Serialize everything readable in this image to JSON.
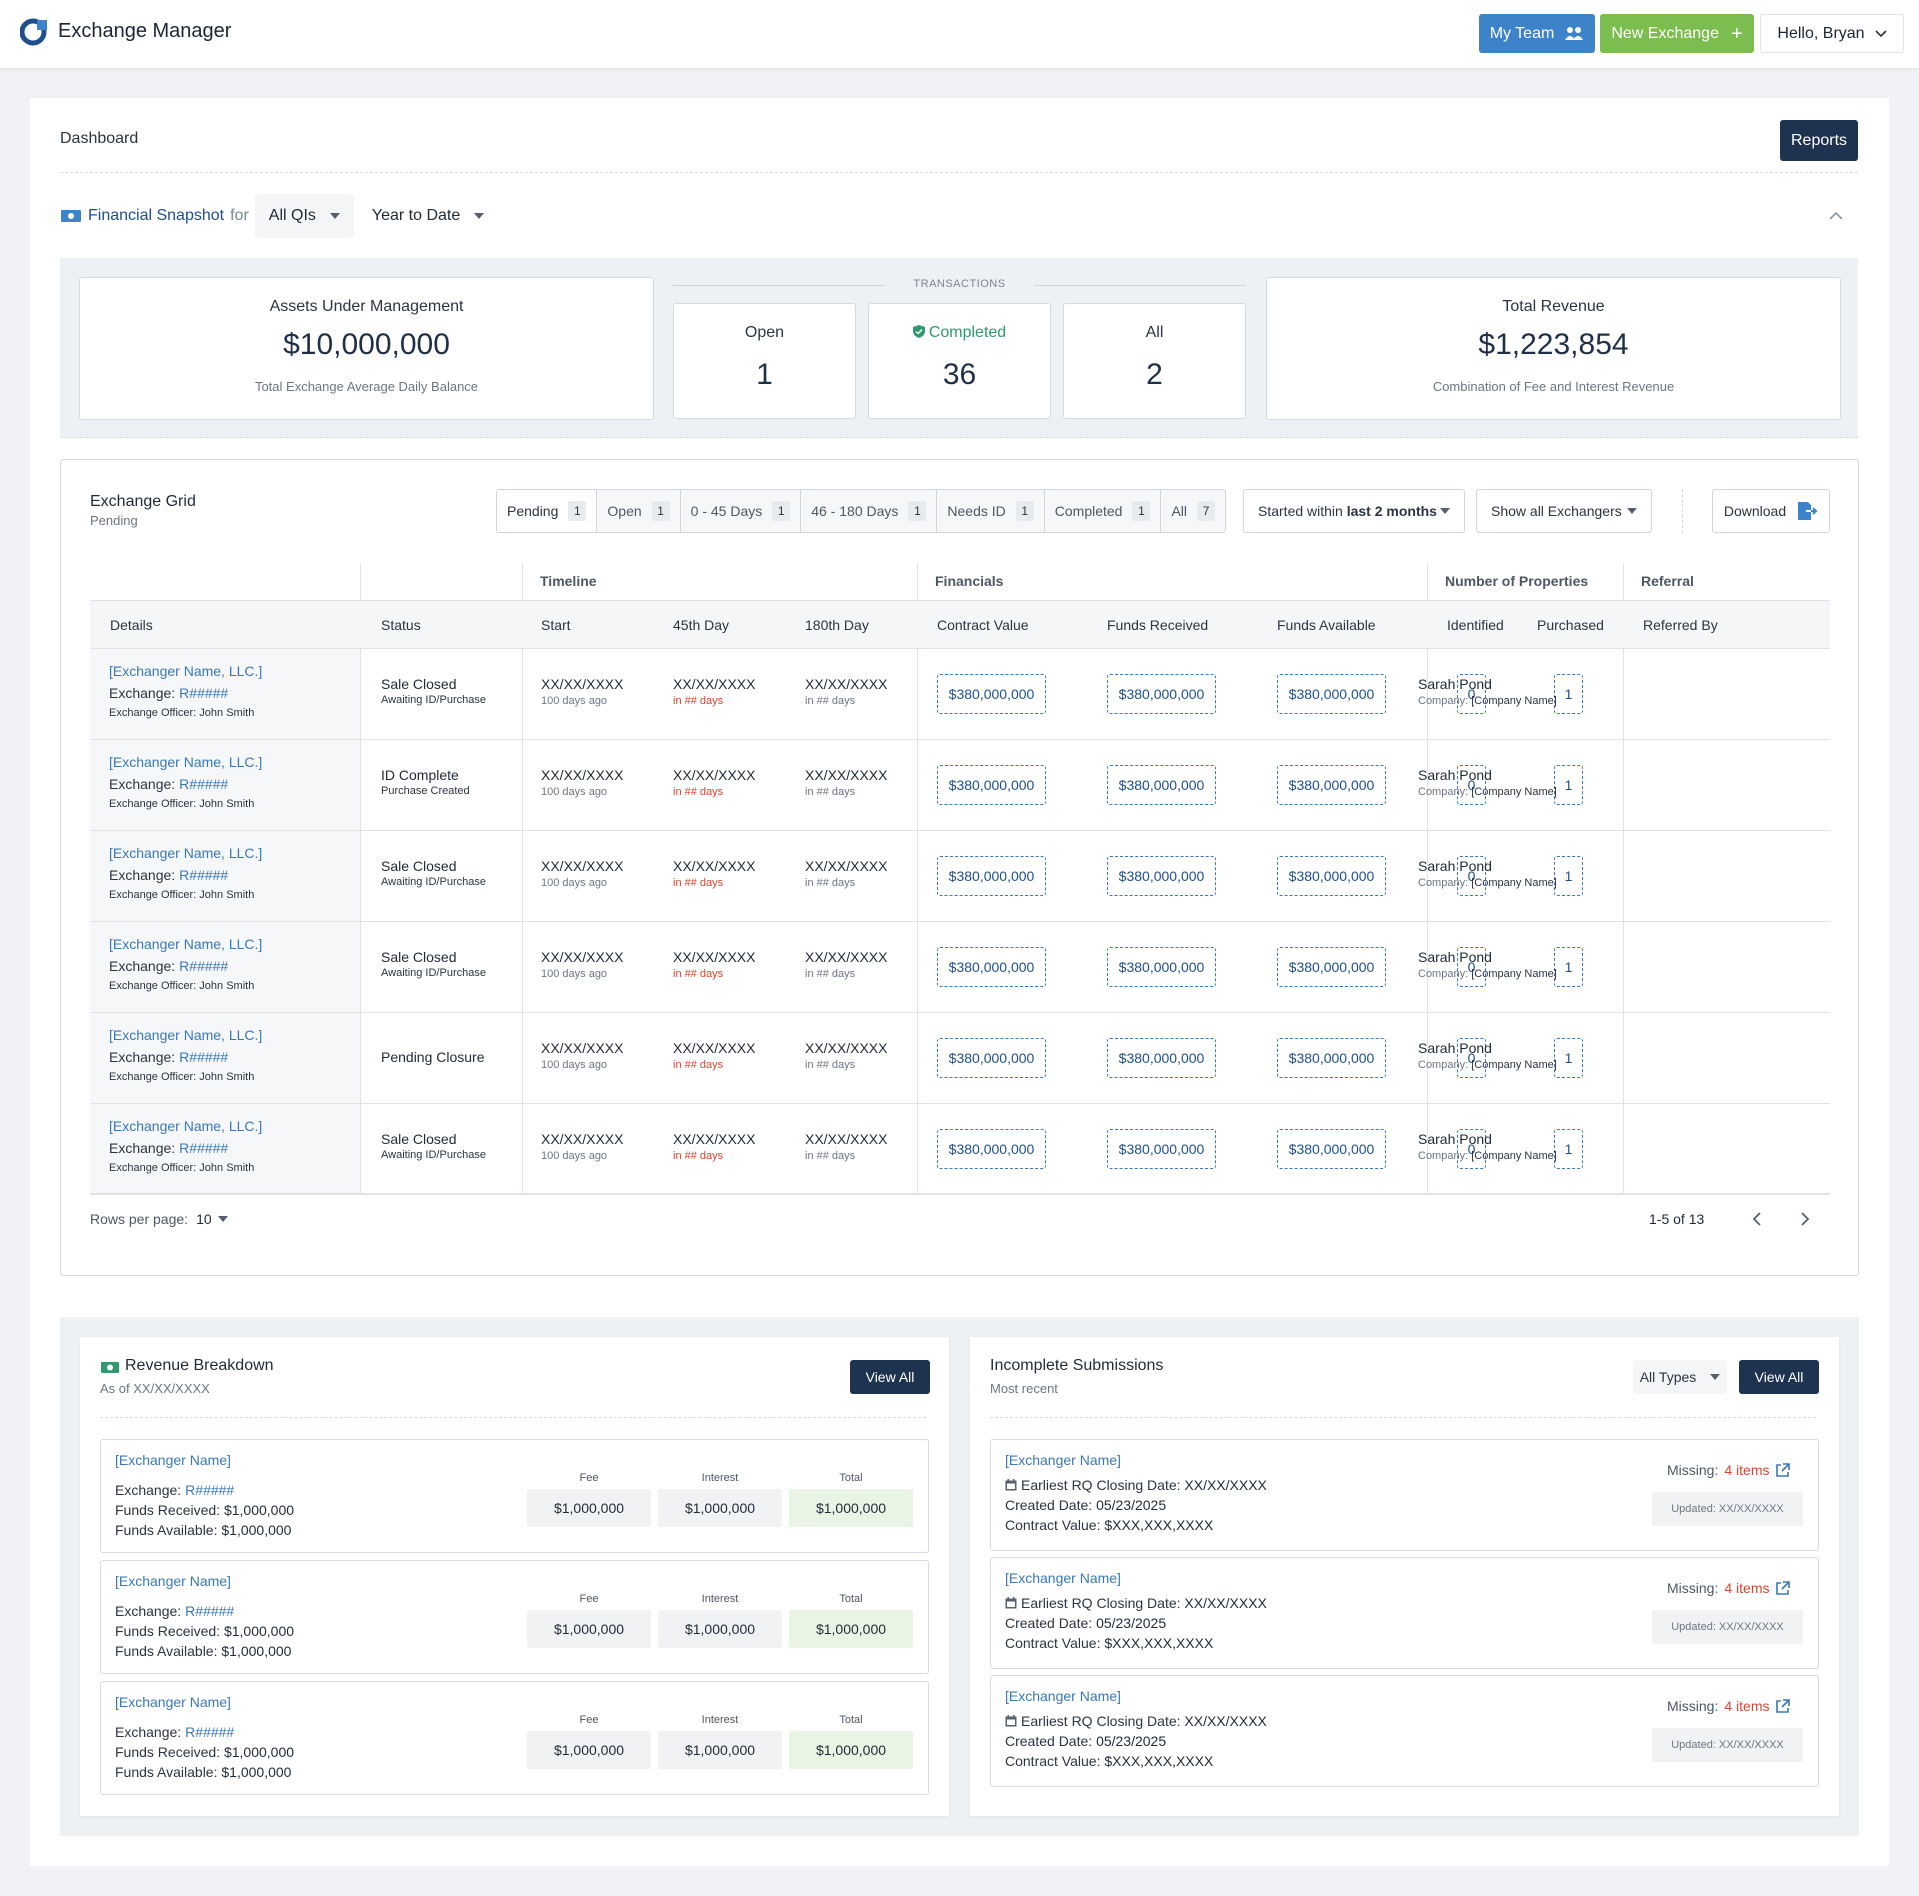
{
  "app": {
    "title": "Exchange Manager"
  },
  "header": {
    "my_team": "My Team",
    "new_exchange": "New Exchange",
    "user_greeting": "Hello, Bryan"
  },
  "dashboard": {
    "title": "Dashboard",
    "reports_button": "Reports"
  },
  "snapshot": {
    "label": "Financial Snapshot",
    "for_text": "for",
    "qi_select": "All QIs",
    "period_select": "Year to Date",
    "aum": {
      "title": "Assets Under Management",
      "value": "$10,000,000",
      "sub": "Total Exchange Average Daily Balance"
    },
    "transactions_label": "TRANSACTIONS",
    "transactions": [
      {
        "label": "Open",
        "value": "1"
      },
      {
        "label": "Completed",
        "value": "36"
      },
      {
        "label": "All",
        "value": "2"
      }
    ],
    "revenue": {
      "title": "Total Revenue",
      "value": "$1,223,854",
      "sub": "Combination of Fee and Interest Revenue"
    }
  },
  "grid": {
    "title": "Exchange Grid",
    "subtitle": "Pending",
    "tabs": [
      {
        "label": "Pending",
        "count": "1"
      },
      {
        "label": "Open",
        "count": "1"
      },
      {
        "label": "0 - 45 Days",
        "count": "1"
      },
      {
        "label": "46 - 180 Days",
        "count": "1"
      },
      {
        "label": "Needs ID",
        "count": "1"
      },
      {
        "label": "Completed",
        "count": "1"
      },
      {
        "label": "All",
        "count": "7"
      }
    ],
    "started_prefix": "Started within",
    "started_value": "last 2 months",
    "show_exchangers": "Show all Exchangers",
    "download": "Download",
    "group_headers": {
      "timeline": "Timeline",
      "financials": "Financials",
      "properties": "Number of Properties",
      "referral": "Referral"
    },
    "columns": {
      "details": "Details",
      "status": "Status",
      "start": "Start",
      "day45": "45th Day",
      "day180": "180th Day",
      "contract": "Contract Value",
      "received": "Funds Received",
      "available": "Funds Available",
      "identified": "Identified",
      "purchased": "Purchased",
      "referred": "Referred By"
    },
    "rows": [
      {
        "name": "[Exchanger Name, LLC.]",
        "exchange_label": "Exchange:",
        "exchange_id": "R#####",
        "officer_label": "Exchange Officer:",
        "officer": "John Smith",
        "status": "Sale Closed",
        "status_sub": "Awaiting ID/Purchase",
        "start": "XX/XX/XXXX",
        "start_sub": "100 days ago",
        "d45": "XX/XX/XXXX",
        "d45_sub": "in ## days",
        "d180": "XX/XX/XXXX",
        "d180_sub": "in ## days",
        "contract": "$380,000,000",
        "received": "$380,000,000",
        "available": "$380,000,000",
        "identified": "0",
        "purchased": "1",
        "ref_name": "Sarah Pond",
        "ref_co_label": "Company:",
        "ref_co": "[Company Name]"
      },
      {
        "name": "[Exchanger Name, LLC.]",
        "exchange_label": "Exchange:",
        "exchange_id": "R#####",
        "officer_label": "Exchange Officer:",
        "officer": "John Smith",
        "status": "ID Complete",
        "status_sub": "Purchase Created",
        "start": "XX/XX/XXXX",
        "start_sub": "100 days ago",
        "d45": "XX/XX/XXXX",
        "d45_sub": "in ## days",
        "d180": "XX/XX/XXXX",
        "d180_sub": "in ## days",
        "contract": "$380,000,000",
        "received": "$380,000,000",
        "available": "$380,000,000",
        "identified": "0",
        "purchased": "1",
        "ref_name": "Sarah Pond",
        "ref_co_label": "Company:",
        "ref_co": "[Company Name]"
      },
      {
        "name": "[Exchanger Name, LLC.]",
        "exchange_label": "Exchange:",
        "exchange_id": "R#####",
        "officer_label": "Exchange Officer:",
        "officer": "John Smith",
        "status": "Sale Closed",
        "status_sub": "Awaiting ID/Purchase",
        "start": "XX/XX/XXXX",
        "start_sub": "100 days ago",
        "d45": "XX/XX/XXXX",
        "d45_sub": "in ## days",
        "d180": "XX/XX/XXXX",
        "d180_sub": "in ## days",
        "contract": "$380,000,000",
        "received": "$380,000,000",
        "available": "$380,000,000",
        "identified": "0",
        "purchased": "1",
        "ref_name": "Sarah Pond",
        "ref_co_label": "Company:",
        "ref_co": "[Company Name]"
      },
      {
        "name": "[Exchanger Name, LLC.]",
        "exchange_label": "Exchange:",
        "exchange_id": "R#####",
        "officer_label": "Exchange Officer:",
        "officer": "John Smith",
        "status": "Sale Closed",
        "status_sub": "Awaiting ID/Purchase",
        "start": "XX/XX/XXXX",
        "start_sub": "100 days ago",
        "d45": "XX/XX/XXXX",
        "d45_sub": "in ## days",
        "d180": "XX/XX/XXXX",
        "d180_sub": "in ## days",
        "contract": "$380,000,000",
        "received": "$380,000,000",
        "available": "$380,000,000",
        "identified": "0",
        "purchased": "1",
        "ref_name": "Sarah Pond",
        "ref_co_label": "Company:",
        "ref_co": "[Company Name]"
      },
      {
        "name": "[Exchanger Name, LLC.]",
        "exchange_label": "Exchange:",
        "exchange_id": "R#####",
        "officer_label": "Exchange Officer:",
        "officer": "John Smith",
        "status": "Pending Closure",
        "status_sub": "",
        "start": "XX/XX/XXXX",
        "start_sub": "100 days ago",
        "d45": "XX/XX/XXXX",
        "d45_sub": "in ## days",
        "d180": "XX/XX/XXXX",
        "d180_sub": "in ## days",
        "contract": "$380,000,000",
        "received": "$380,000,000",
        "available": "$380,000,000",
        "identified": "0",
        "purchased": "1",
        "ref_name": "Sarah Pond",
        "ref_co_label": "Company:",
        "ref_co": "[Company Name]"
      },
      {
        "name": "[Exchanger Name, LLC.]",
        "exchange_label": "Exchange:",
        "exchange_id": "R#####",
        "officer_label": "Exchange Officer:",
        "officer": "John Smith",
        "status": "Sale Closed",
        "status_sub": "Awaiting ID/Purchase",
        "start": "XX/XX/XXXX",
        "start_sub": "100 days ago",
        "d45": "XX/XX/XXXX",
        "d45_sub": "in ## days",
        "d180": "XX/XX/XXXX",
        "d180_sub": "in ## days",
        "contract": "$380,000,000",
        "received": "$380,000,000",
        "available": "$380,000,000",
        "identified": "0",
        "purchased": "1",
        "ref_name": "Sarah Pond",
        "ref_co_label": "Company:",
        "ref_co": "[Company Name]"
      }
    ],
    "rows_per_page_label": "Rows per page:",
    "rows_per_page": "10",
    "pagination": "1-5 of 13"
  },
  "revenue_breakdown": {
    "title": "Revenue Breakdown",
    "subtitle": "As of XX/XX/XXXX",
    "view_all": "View All",
    "items": [
      {
        "name": "[Exchanger Name]",
        "exchange_label": "Exchange:",
        "exchange_id": "R#####",
        "received_label": "Funds Received:",
        "received": "$1,000,000",
        "available_label": "Funds Available:",
        "available": "$1,000,000",
        "fee_label": "Fee",
        "fee": "$1,000,000",
        "interest_label": "Interest",
        "interest": "$1,000,000",
        "total_label": "Total",
        "total": "$1,000,000"
      },
      {
        "name": "[Exchanger Name]",
        "exchange_label": "Exchange:",
        "exchange_id": "R#####",
        "received_label": "Funds Received:",
        "received": "$1,000,000",
        "available_label": "Funds Available:",
        "available": "$1,000,000",
        "fee_label": "Fee",
        "fee": "$1,000,000",
        "interest_label": "Interest",
        "interest": "$1,000,000",
        "total_label": "Total",
        "total": "$1,000,000"
      },
      {
        "name": "[Exchanger Name]",
        "exchange_label": "Exchange:",
        "exchange_id": "R#####",
        "received_label": "Funds Received:",
        "received": "$1,000,000",
        "available_label": "Funds Available:",
        "available": "$1,000,000",
        "fee_label": "Fee",
        "fee": "$1,000,000",
        "interest_label": "Interest",
        "interest": "$1,000,000",
        "total_label": "Total",
        "total": "$1,000,000"
      }
    ]
  },
  "incomplete": {
    "title": "Incomplete Submissions",
    "subtitle": "Most recent",
    "type_select": "All Types",
    "view_all": "View All",
    "items": [
      {
        "name": "[Exchanger Name]",
        "closing_label": "Earliest RQ Closing Date:",
        "closing": "XX/XX/XXXX",
        "created_label": "Created Date:",
        "created": "05/23/2025",
        "contract_label": "Contract Value:",
        "contract": "$XXX,XXX,XXXX",
        "missing_label": "Missing:",
        "missing": "4 items",
        "updated": "Updated: XX/XX/XXXX"
      },
      {
        "name": "[Exchanger Name]",
        "closing_label": "Earliest RQ Closing Date:",
        "closing": "XX/XX/XXXX",
        "created_label": "Created Date:",
        "created": "05/23/2025",
        "contract_label": "Contract Value:",
        "contract": "$XXX,XXX,XXXX",
        "missing_label": "Missing:",
        "missing": "4 items",
        "updated": "Updated: XX/XX/XXXX"
      },
      {
        "name": "[Exchanger Name]",
        "closing_label": "Earliest RQ Closing Date:",
        "closing": "XX/XX/XXXX",
        "created_label": "Created Date:",
        "created": "05/23/2025",
        "contract_label": "Contract Value:",
        "contract": "$XXX,XXX,XXXX",
        "missing_label": "Missing:",
        "missing": "4 items",
        "updated": "Updated: XX/XX/XXXX"
      }
    ]
  },
  "colors": {
    "primary": "#1e3350",
    "team": "#3c83c9",
    "new": "#7bbd4f",
    "link": "#3a78b5",
    "alert": "#d9442f",
    "success": "#2e9a6d"
  }
}
